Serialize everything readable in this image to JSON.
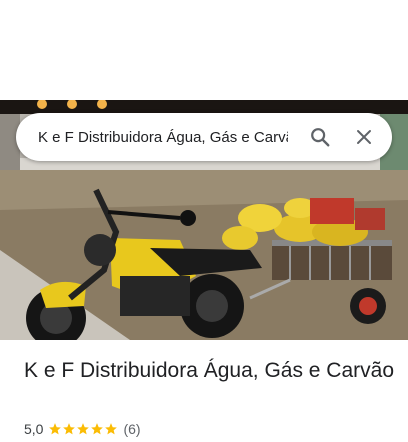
{
  "search": {
    "query": "K e F Distribuidora Água, Gás e Carvão"
  },
  "place": {
    "title": "K e F Distribuidora Água, Gás e Carvão",
    "rating": "5,0",
    "stars": 5,
    "review_count": "(6)"
  },
  "colors": {
    "star": "#fbbc04",
    "text": "#202124",
    "secondary_text": "#5f6368",
    "icon": "#5f6368"
  },
  "icons": {
    "search": "search-icon",
    "close": "close-icon",
    "star": "star-icon"
  }
}
